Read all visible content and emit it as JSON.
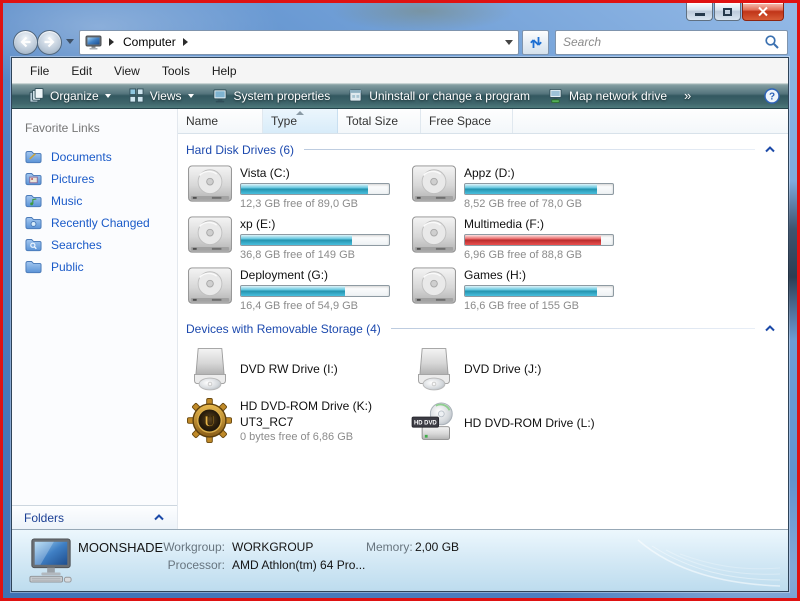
{
  "navigation": {
    "breadcrumb_root": "Computer",
    "search_placeholder": "Search"
  },
  "menu_bar": {
    "items": [
      "File",
      "Edit",
      "View",
      "Tools",
      "Help"
    ]
  },
  "toolbar": {
    "organize": "Organize",
    "views": "Views",
    "system_properties": "System properties",
    "uninstall": "Uninstall or change a program",
    "map_network_drive": "Map network drive",
    "overflow": "»",
    "help_glyph": "?"
  },
  "list_columns": {
    "name": "Name",
    "type": "Type",
    "total_size": "Total Size",
    "free_space": "Free Space"
  },
  "sidebar": {
    "title": "Favorite Links",
    "items": [
      "Documents",
      "Pictures",
      "Music",
      "Recently Changed",
      "Searches",
      "Public"
    ],
    "folders": "Folders"
  },
  "status_colors": {
    "capacity_normal": "#2cb2d4",
    "capacity_low": "#e13535"
  },
  "groups": {
    "hard_disks": {
      "title": "Hard Disk Drives (6)",
      "drives": [
        {
          "name": "Vista (C:)",
          "free": "12,3 GB free of 89,0 GB",
          "used_pct": 86,
          "bar": "#2cb2d4"
        },
        {
          "name": "Appz (D:)",
          "free": "8,52 GB free of 78,0 GB",
          "used_pct": 89,
          "bar": "#2cb2d4"
        },
        {
          "name": "xp (E:)",
          "free": "36,8 GB free of 149 GB",
          "used_pct": 75,
          "bar": "#2cb2d4"
        },
        {
          "name": "Multimedia (F:)",
          "free": "6,96 GB free of 88,8 GB",
          "used_pct": 92,
          "bar": "#e13535"
        },
        {
          "name": "Deployment (G:)",
          "free": "16,4 GB free of 54,9 GB",
          "used_pct": 70,
          "bar": "#2cb2d4"
        },
        {
          "name": "Games (H:)",
          "free": "16,6 GB free of 155 GB",
          "used_pct": 89,
          "bar": "#2cb2d4"
        }
      ]
    },
    "removable": {
      "title": "Devices with Removable Storage (4)",
      "devices": [
        {
          "name": "DVD RW Drive (I:)"
        },
        {
          "name": "DVD Drive (J:)"
        },
        {
          "name": "HD DVD-ROM Drive (K:)",
          "label": "UT3_RC7",
          "free": "0 bytes free of 6,86 GB",
          "icon_letter": "U"
        },
        {
          "name": "HD DVD-ROM Drive (L:)",
          "badge": "HD DVD"
        }
      ]
    }
  },
  "details_pane": {
    "computer_name": "MOONSHADE",
    "workgroup_label": "Workgroup:",
    "workgroup": "WORKGROUP",
    "processor_label": "Processor:",
    "processor": "AMD Athlon(tm) 64 Pro...",
    "memory_label": "Memory:",
    "memory": "2,00 GB"
  }
}
